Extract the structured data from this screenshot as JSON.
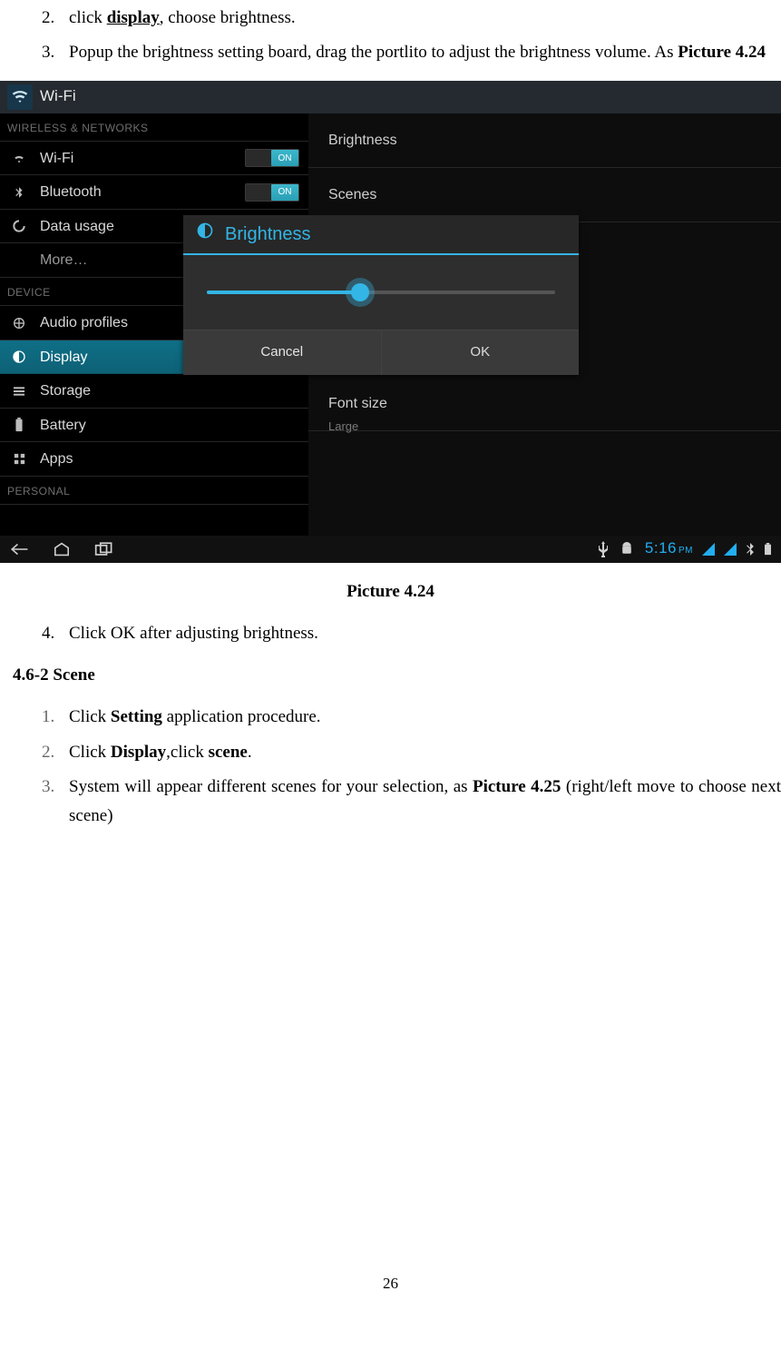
{
  "steps_top": [
    {
      "num": "2.",
      "html": "click <b><u>display</u></b>, choose brightness."
    },
    {
      "num": "3.",
      "html": "Popup the brightness setting board, drag the portlito to adjust the brightness volume. As <b>Picture 4.24</b>"
    }
  ],
  "caption": "Picture 4.24",
  "step4": {
    "num": "4.",
    "text": "Click OK after adjusting brightness."
  },
  "section": "4.6-2 Scene",
  "scene_steps": [
    {
      "num": "1.",
      "html": "Click <b>Setting</b> application procedure."
    },
    {
      "num": "2.",
      "html": "Click <b>Display</b>,click <b>scene</b>."
    },
    {
      "num": "3.",
      "html": "System will appear different scenes for your selection, as <b>Picture 4.25</b> (right/left move to choose next scene)"
    }
  ],
  "page_number": "26",
  "shot": {
    "title": "Wi-Fi",
    "sections": {
      "wireless": "WIRELESS & NETWORKS",
      "device": "DEVICE",
      "personal": "PERSONAL"
    },
    "sidebar": {
      "wifi": "Wi-Fi",
      "bluetooth": "Bluetooth",
      "data": "Data usage",
      "more": "More…",
      "audio": "Audio profiles",
      "display": "Display",
      "storage": "Storage",
      "battery": "Battery",
      "apps": "Apps"
    },
    "toggle_on": "ON",
    "right": {
      "brightness": "Brightness",
      "scenes": "Scenes",
      "font_size": "Font size",
      "font_value": "Large"
    },
    "dialog": {
      "title": "Brightness",
      "cancel": "Cancel",
      "ok": "OK"
    },
    "clock": {
      "time": "5:16",
      "suffix": "PM"
    }
  }
}
